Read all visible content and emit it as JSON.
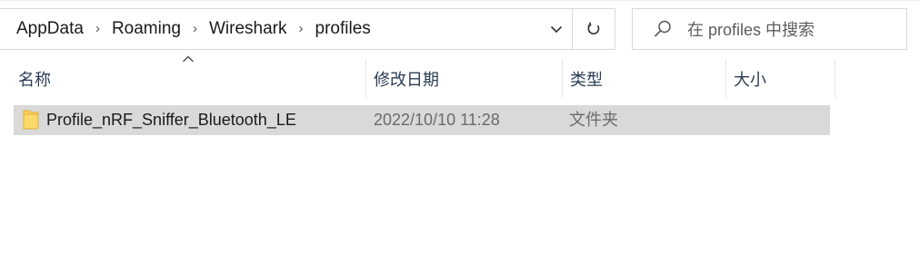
{
  "address_bar": {
    "leading_overflow": "«",
    "crumbs": [
      "AppData",
      "Roaming",
      "Wireshark",
      "profiles"
    ],
    "separator": "›"
  },
  "search": {
    "placeholder": "在 profiles 中搜索"
  },
  "columns": {
    "name": "名称",
    "date_modified": "修改日期",
    "type": "类型",
    "size": "大小"
  },
  "rows": [
    {
      "name": "Profile_nRF_Sniffer_Bluetooth_LE",
      "date_modified": "2022/10/10 11:28",
      "type": "文件夹",
      "size": "",
      "icon": "folder-icon"
    }
  ],
  "colors": {
    "selected_row": "#d9d9d9",
    "header_text": "#2b3d55",
    "folder_yellow": "#f8cf5c",
    "border": "#d9d9d9"
  }
}
